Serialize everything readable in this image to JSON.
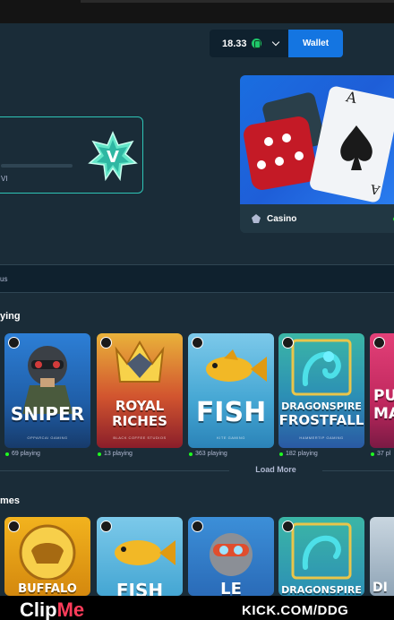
{
  "header": {
    "balance": "18.33",
    "wallet_label": "Wallet"
  },
  "vip": {
    "label": "VI",
    "badge_letter": "V"
  },
  "casino_card": {
    "label": "Casino"
  },
  "search": {
    "partial_text": "us"
  },
  "sections": {
    "trending_title": "ying",
    "more_title": "mes"
  },
  "trending_games": [
    {
      "name_line1": "SNIPER",
      "name_line2": "",
      "studio": "OPPARCAI GAMING",
      "players": "69 playing"
    },
    {
      "name_line1": "ROYAL",
      "name_line2": "RICHES",
      "studio": "BLACK COFFEE STUDIOS",
      "players": "13 playing"
    },
    {
      "name_line1": "FISH",
      "name_line2": "",
      "studio": "KITE GAMING",
      "players": "363 playing"
    },
    {
      "name_line1": "DRAGONSPIRE",
      "name_line2": "FROSTFALL",
      "studio": "HAMMERTIP GAMING",
      "players": "182 playing"
    },
    {
      "name_line1": "PU",
      "name_line2": "MA",
      "studio": "",
      "players": "37 pl"
    }
  ],
  "load_more_label": "Load More",
  "more_games": [
    {
      "name": "BUFFALO"
    },
    {
      "name": "FISH"
    },
    {
      "name": "LE"
    },
    {
      "name": "DRAGONSPIRE"
    },
    {
      "name": "DI"
    }
  ],
  "watermark": {
    "brand_clip": "Clip",
    "brand_me": "Me",
    "channel": "KICK.COM/DDG"
  },
  "colors": {
    "background": "#0f212e",
    "panel": "#1a2c38",
    "accent_blue": "#1475e1",
    "live_green": "#1fff20"
  }
}
